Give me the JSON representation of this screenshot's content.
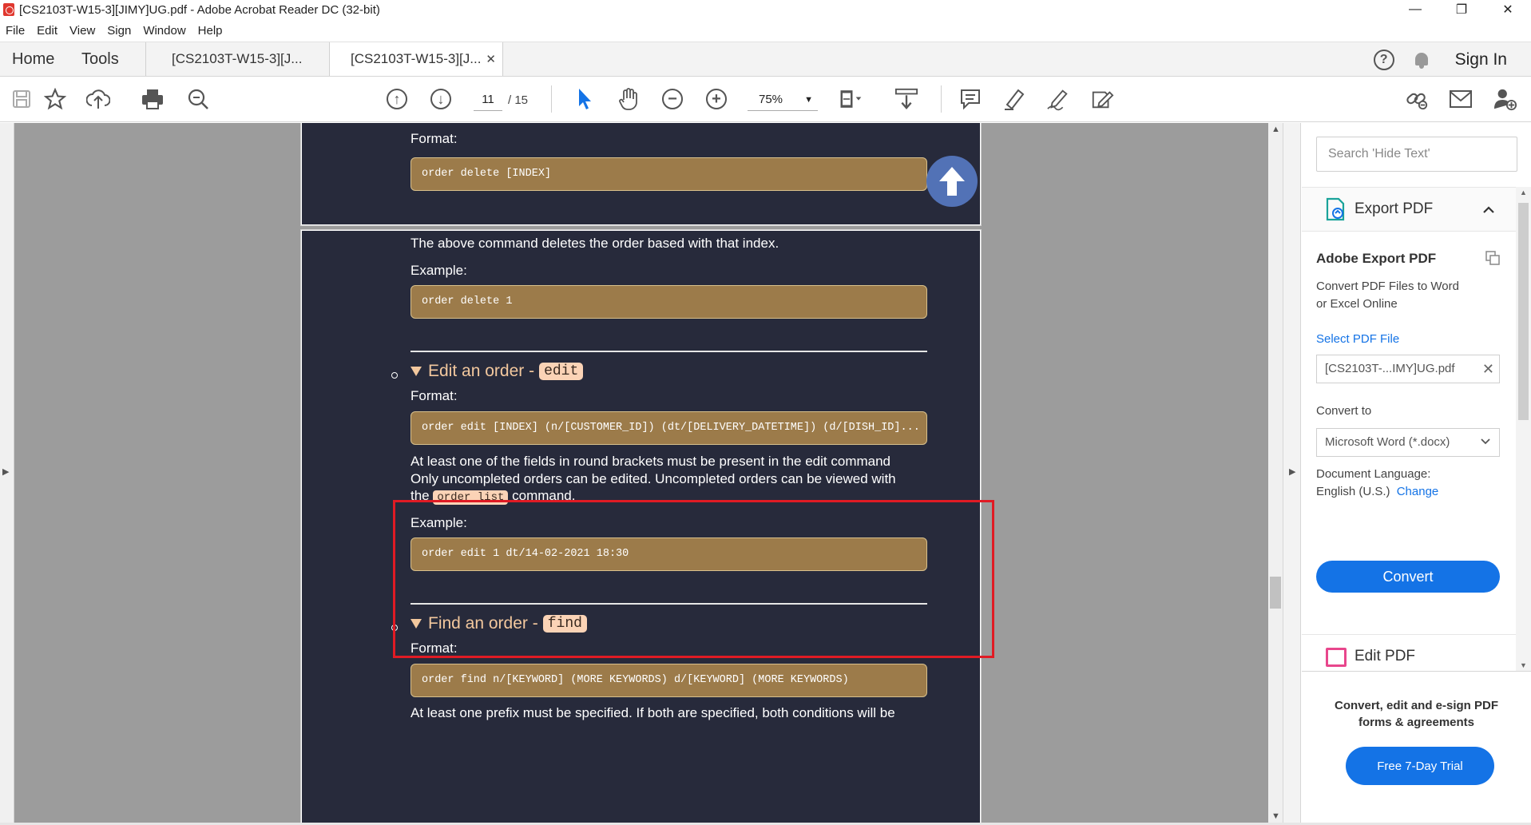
{
  "window": {
    "title": "[CS2103T-W15-3][JIMY]UG.pdf - Adobe Acrobat Reader DC (32-bit)",
    "min": "—",
    "restore": "❐",
    "close": "✕"
  },
  "menu": [
    "File",
    "Edit",
    "View",
    "Sign",
    "Window",
    "Help"
  ],
  "tabs": {
    "home": "Home",
    "tools": "Tools",
    "doc1": "[CS2103T-W15-3][J...",
    "doc2": "[CS2103T-W15-3][J...",
    "close": "✕",
    "signin": "Sign In",
    "help": "?"
  },
  "toolbar": {
    "page_current": "11",
    "page_total": "/ 15",
    "zoom": "75%",
    "zoom_caret": "▼"
  },
  "document": {
    "page1": {
      "format_label": "Format:",
      "code": "order delete [INDEX]"
    },
    "page2": {
      "desc": "The above command deletes the order based with that index.",
      "example_label": "Example:",
      "example_code": "order delete 1",
      "edit_heading": "Edit an order -",
      "edit_pill": "edit",
      "edit_format_label": "Format:",
      "edit_code": "order edit [INDEX] (n/[CUSTOMER_ID]) (dt/[DELIVERY_DATETIME]) (d/[DISH_ID]...",
      "edit_line1": "At least one of the fields in round brackets must be present in the edit command",
      "edit_line2": "Only uncompleted orders can be edited. Uncompleted orders can be viewed with",
      "edit_line3_pre": "the",
      "edit_line3_code": "order list",
      "edit_line3_post": "command.",
      "edit_example_label": "Example:",
      "edit_example_code": "order edit 1 dt/14-02-2021 18:30",
      "find_heading": "Find an order -",
      "find_pill": "find",
      "find_format_label": "Format:",
      "find_code": "order find n/[KEYWORD] (MORE KEYWORDS) d/[KEYWORD] (MORE KEYWORDS)",
      "find_line1": "At least one prefix must be specified. If both are specified, both conditions will be"
    }
  },
  "side_panel": {
    "search_placeholder": "Search 'Hide Text'",
    "export_title": "Export PDF",
    "export_chevron": "⌃",
    "heading": "Adobe Export PDF",
    "desc_line1": "Convert PDF Files to Word",
    "desc_line2": "or Excel Online",
    "select_file": "Select PDF File",
    "file_name": "[CS2103T-...IMY]UG.pdf",
    "file_clear": "✕",
    "convert_to_label": "Convert to",
    "convert_to_value": "Microsoft Word (*.docx)",
    "convert_to_caret": "⌄",
    "doc_lang_label": "Document Language:",
    "doc_lang_value": "English (U.S.)",
    "change_link": "Change",
    "convert_button": "Convert",
    "edit_pdf_title": "Edit PDF",
    "promo_line1": "Convert, edit and e-sign PDF",
    "promo_line2": "forms & agreements",
    "trial_button": "Free 7-Day Trial"
  },
  "colors": {
    "page_bg": "#272a3b",
    "code_bg": "#9c7b4a",
    "heading": "#f3c89e",
    "pill_bg": "#fbd3b6",
    "accent": "#1473e6",
    "highlight_box": "#e01b24",
    "up_button": "#5272b6"
  }
}
